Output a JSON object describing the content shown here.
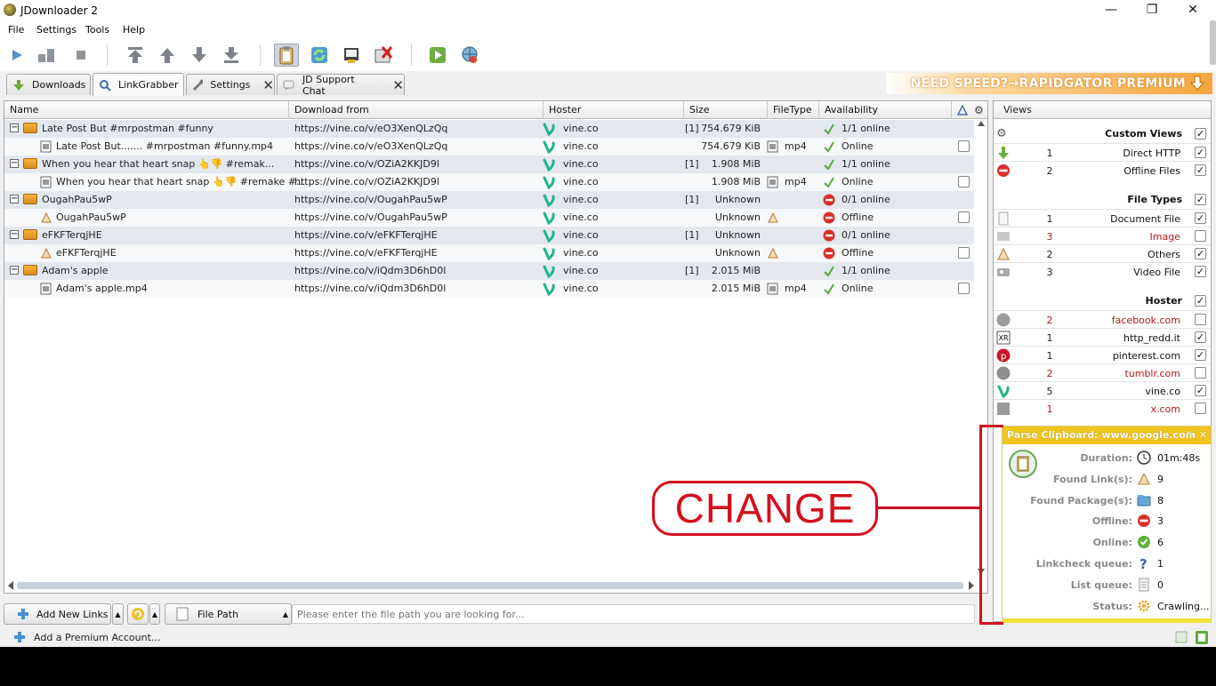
{
  "window": {
    "title": "JDownloader 2",
    "controls": {
      "minimize": "—",
      "maximize": "❐",
      "close": "✕"
    }
  },
  "menu": [
    "File",
    "Settings",
    "Tools",
    "Help"
  ],
  "tabs": [
    {
      "label": "Downloads",
      "active": false,
      "closable": false
    },
    {
      "label": "LinkGrabber",
      "active": true,
      "closable": false
    },
    {
      "label": "Settings",
      "active": false,
      "closable": true
    },
    {
      "label": "JD Support Chat",
      "active": false,
      "closable": true
    }
  ],
  "promo": "NEED SPEED?→RAPIDGATOR PREMIUM",
  "columns": [
    "Name",
    "Download from",
    "Hoster",
    "Size",
    "FileType",
    "Availability"
  ],
  "rows": [
    {
      "type": "package",
      "name": "Late Post But  #mrpostman #funny",
      "from": "https://vine.co/v/eO3XenQLzQq",
      "hoster": "vine.co",
      "count": "[1]",
      "size": "754.679 KiB",
      "filetype": "",
      "avail": "1/1 online",
      "status": "ok"
    },
    {
      "type": "link",
      "name": "Late Post But....... #mrpostman #funny.mp4",
      "from": "https://vine.co/v/eO3XenQLzQq",
      "hoster": "vine.co",
      "count": "",
      "size": "754.679 KiB",
      "filetype": "mp4",
      "avail": "Online",
      "status": "ok",
      "ficon": "video"
    },
    {
      "type": "package",
      "name": "When you hear that heart snap 👆👎 #remak...",
      "from": "https://vine.co/v/OZiA2KKJD9l",
      "hoster": "vine.co",
      "count": "[1]",
      "size": "1.908 MiB",
      "filetype": "",
      "avail": "1/1 online",
      "status": "ok"
    },
    {
      "type": "link",
      "name": "When you hear that heart snap 👆👎 #remake #...",
      "from": "https://vine.co/v/OZiA2KKJD9l",
      "hoster": "vine.co",
      "count": "",
      "size": "1.908 MiB",
      "filetype": "mp4",
      "avail": "Online",
      "status": "ok",
      "ficon": "video"
    },
    {
      "type": "package",
      "name": "OugahPau5wP",
      "from": "https://vine.co/v/OugahPau5wP",
      "hoster": "vine.co",
      "count": "[1]",
      "size": "Unknown",
      "filetype": "",
      "avail": "0/1 online",
      "status": "bad"
    },
    {
      "type": "link",
      "name": "OugahPau5wP",
      "from": "https://vine.co/v/OugahPau5wP",
      "hoster": "vine.co",
      "count": "",
      "size": "Unknown",
      "filetype": "",
      "avail": "Offline",
      "status": "bad",
      "ficon": "other"
    },
    {
      "type": "package",
      "name": "eFKFTerqjHE",
      "from": "https://vine.co/v/eFKFTerqjHE",
      "hoster": "vine.co",
      "count": "[1]",
      "size": "Unknown",
      "filetype": "",
      "avail": "0/1 online",
      "status": "bad"
    },
    {
      "type": "link",
      "name": "eFKFTerqjHE",
      "from": "https://vine.co/v/eFKFTerqjHE",
      "hoster": "vine.co",
      "count": "",
      "size": "Unknown",
      "filetype": "",
      "avail": "Offline",
      "status": "bad",
      "ficon": "other"
    },
    {
      "type": "package",
      "name": "Adam's apple",
      "from": "https://vine.co/v/iQdm3D6hD0l",
      "hoster": "vine.co",
      "count": "[1]",
      "size": "2.015 MiB",
      "filetype": "",
      "avail": "1/1 online",
      "status": "ok"
    },
    {
      "type": "link",
      "name": "Adam's apple.mp4",
      "from": "https://vine.co/v/iQdm3D6hD0l",
      "hoster": "vine.co",
      "count": "",
      "size": "2.015 MiB",
      "filetype": "mp4",
      "avail": "Online",
      "status": "ok",
      "ficon": "video"
    }
  ],
  "views": {
    "title": "Views",
    "sections": [
      {
        "title": "Custom Views",
        "checked": true,
        "icon": "gear-icon",
        "items": [
          {
            "count": "1",
            "label": "Direct HTTP",
            "checked": true,
            "red": false,
            "icon": "download-arrow-icon"
          },
          {
            "count": "2",
            "label": "Offline Files",
            "checked": true,
            "red": false,
            "icon": "offline-icon"
          }
        ]
      },
      {
        "title": "File Types",
        "checked": true,
        "items": [
          {
            "count": "1",
            "label": "Document File",
            "checked": true,
            "red": false,
            "icon": "document-icon"
          },
          {
            "count": "3",
            "label": "Image",
            "checked": false,
            "red": true,
            "icon": "image-icon"
          },
          {
            "count": "2",
            "label": "Others",
            "checked": true,
            "red": false,
            "icon": "others-icon"
          },
          {
            "count": "3",
            "label": "Video File",
            "checked": true,
            "red": false,
            "icon": "video-file-icon"
          }
        ]
      },
      {
        "title": "Hoster",
        "checked": true,
        "items": [
          {
            "count": "2",
            "label": "facebook.com",
            "checked": false,
            "red": true,
            "icon": "facebook-icon"
          },
          {
            "count": "1",
            "label": "http_redd.it",
            "checked": true,
            "red": false,
            "icon": "reddit-icon"
          },
          {
            "count": "1",
            "label": "pinterest.com",
            "checked": true,
            "red": false,
            "icon": "pinterest-icon"
          },
          {
            "count": "2",
            "label": "tumblr.com",
            "checked": false,
            "red": true,
            "icon": "tumblr-icon"
          },
          {
            "count": "5",
            "label": "vine.co",
            "checked": true,
            "red": false,
            "icon": "vine-icon"
          },
          {
            "count": "1",
            "label": "x.com",
            "checked": false,
            "red": true,
            "icon": "x-icon"
          }
        ]
      }
    ]
  },
  "parse": {
    "title": "Parse Clipboard: www.google.com",
    "rows": [
      {
        "label": "Duration:",
        "value": "01m:48s",
        "icon": "clock-icon"
      },
      {
        "label": "Found Link(s):",
        "value": "9",
        "icon": "links-icon"
      },
      {
        "label": "Found Package(s):",
        "value": "8",
        "icon": "package-icon"
      },
      {
        "label": "Offline:",
        "value": "3",
        "icon": "offline-icon"
      },
      {
        "label": "Online:",
        "value": "6",
        "icon": "online-icon"
      },
      {
        "label": "Linkcheck queue:",
        "value": "1",
        "icon": "question-icon"
      },
      {
        "label": "List queue:",
        "value": "0",
        "icon": "list-icon"
      },
      {
        "label": "Status:",
        "value": "Crawling...",
        "icon": "crawling-icon"
      }
    ]
  },
  "bottom": {
    "add_links": "Add New Links",
    "file_path": "File Path",
    "search_placeholder": "Please enter the file path you are looking for..."
  },
  "status_bar": {
    "premium": "Add a Premium Account..."
  },
  "annotation": {
    "text": "CHANGE",
    "color": "#d4101e"
  }
}
